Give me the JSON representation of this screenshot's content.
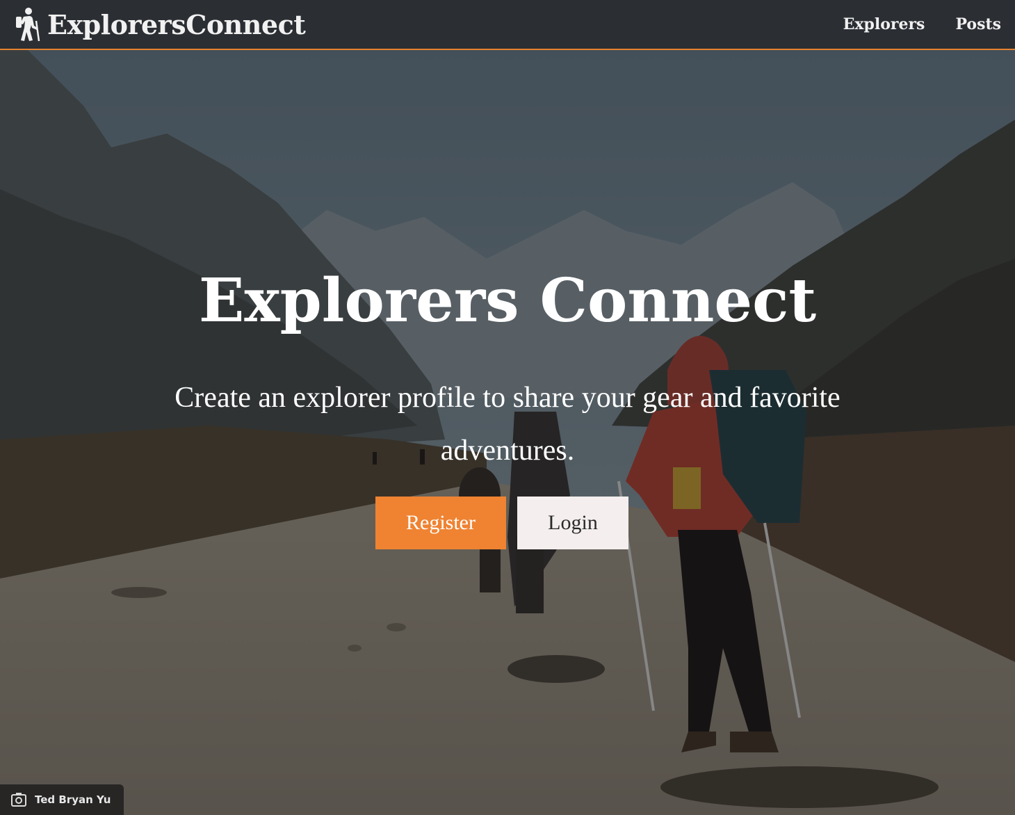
{
  "brand": {
    "name": "ExplorersConnect",
    "icon": "hiker-icon"
  },
  "nav": {
    "items": [
      {
        "label": "Explorers"
      },
      {
        "label": "Posts"
      }
    ]
  },
  "hero": {
    "title": "Explorers Connect",
    "subtitle": "Create an explorer profile to share your gear and favorite adventures.",
    "register_label": "Register",
    "login_label": "Login"
  },
  "photo_credit": {
    "name": "Ted Bryan Yu",
    "icon": "camera-icon"
  },
  "colors": {
    "accent": "#ef8332",
    "navbar": "#2b2e33",
    "login_bg": "#f4eeee"
  }
}
